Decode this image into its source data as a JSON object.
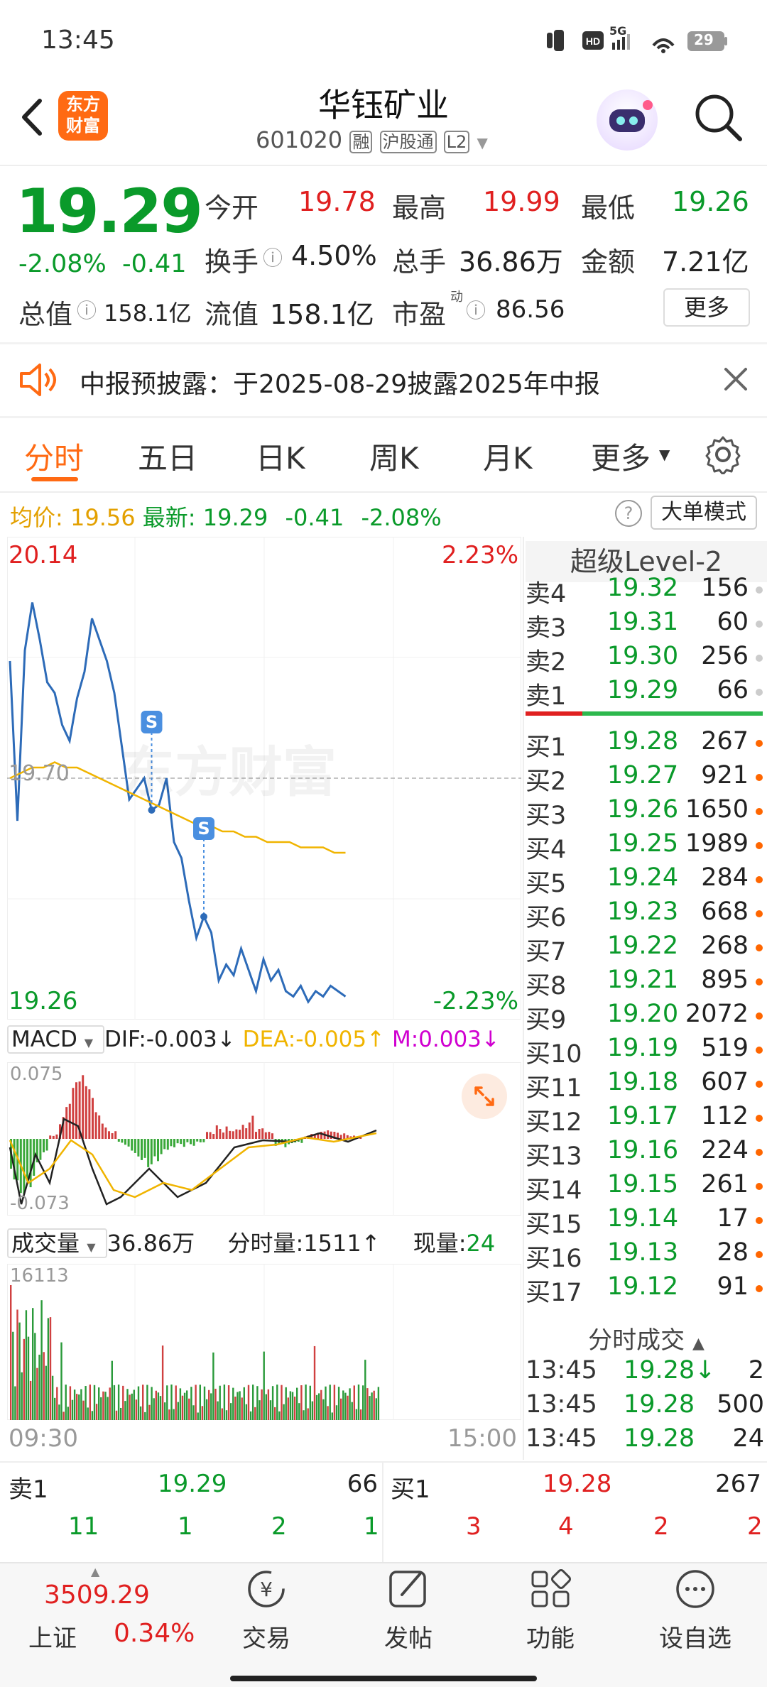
{
  "status": {
    "time": "13:45",
    "battery": "29",
    "network": "5G"
  },
  "header": {
    "title": "华钰矿业",
    "code": "601020",
    "tags": [
      "融",
      "沪股通",
      "L2"
    ],
    "logo_text": "东方财富"
  },
  "quote": {
    "price": "19.29",
    "change_pct": "-2.08%",
    "change": "-0.41",
    "open_label": "今开",
    "open": "19.78",
    "high_label": "最高",
    "high": "19.99",
    "low_label": "最低",
    "low": "19.26",
    "turnover_label": "换手",
    "turnover": "4.50%",
    "volume_label": "总手",
    "volume": "36.86万",
    "amount_label": "金额",
    "amount": "7.21亿",
    "mktcap_label": "总值",
    "mktcap": "158.1亿",
    "float_label": "流值",
    "float": "158.1亿",
    "pe_label": "市盈",
    "pe_sup": "动",
    "pe": "86.56",
    "more_label": "更多"
  },
  "notice": {
    "text": "中报预披露：于2025-08-29披露2025年中报"
  },
  "tabs": [
    {
      "label": "分时"
    },
    {
      "label": "五日"
    },
    {
      "label": "日K"
    },
    {
      "label": "周K"
    },
    {
      "label": "月K"
    },
    {
      "label": "更多"
    }
  ],
  "info_bar": {
    "avg_label": "均价:",
    "avg": "19.56",
    "latest_label": "最新:",
    "latest": "19.29",
    "chg": "-0.41",
    "pct": "-2.08%",
    "mode_btn": "大单模式"
  },
  "chart_data": {
    "type": "line",
    "title": "",
    "y_top_label": "20.14",
    "y_bottom_label": "19.26",
    "y_mid_label": "19.70",
    "pct_top_label": "2.23%",
    "pct_bottom_label": "-2.23%",
    "ylim": [
      19.26,
      20.14
    ],
    "x_start_label": "09:30",
    "x_end_label": "15:00",
    "watermark": "东方财富",
    "markers": [
      "S",
      "S"
    ],
    "price_series": [
      19.92,
      19.62,
      19.94,
      20.03,
      19.96,
      19.88,
      19.86,
      19.8,
      19.77,
      19.85,
      19.9,
      20.0,
      19.96,
      19.92,
      19.86,
      19.76,
      19.66,
      19.68,
      19.7,
      19.64,
      19.65,
      19.7,
      19.58,
      19.55,
      19.47,
      19.4,
      19.44,
      19.41,
      19.32,
      19.35,
      19.33,
      19.38,
      19.34,
      19.3,
      19.36,
      19.32,
      19.34,
      19.3,
      19.29,
      19.31,
      19.28,
      19.3,
      19.29,
      19.31,
      19.3,
      19.29
    ],
    "avg_series": [
      19.7,
      19.71,
      19.72,
      19.72,
      19.73,
      19.72,
      19.72,
      19.71,
      19.7,
      19.69,
      19.68,
      19.67,
      19.66,
      19.65,
      19.64,
      19.63,
      19.62,
      19.61,
      19.61,
      19.6,
      19.6,
      19.59,
      19.59,
      19.58,
      19.58,
      19.58,
      19.57,
      19.57,
      19.57,
      19.56,
      19.56
    ]
  },
  "macd": {
    "name": "MACD",
    "dif": "DIF:-0.003↓",
    "dea": "DEA:-0.005↑",
    "m": "M:0.003↓",
    "top": "0.075",
    "bottom": "-0.073"
  },
  "volume": {
    "name": "成交量",
    "total": "36.86万",
    "tick_label": "分时量:1511↑",
    "now_label": "现量:",
    "now": "24",
    "max": "16113"
  },
  "level2": {
    "title": "超级Level-2",
    "asks": [
      {
        "name": "卖4",
        "price": "19.32",
        "vol": "156"
      },
      {
        "name": "卖3",
        "price": "19.31",
        "vol": "60"
      },
      {
        "name": "卖2",
        "price": "19.30",
        "vol": "256"
      },
      {
        "name": "卖1",
        "price": "19.29",
        "vol": "66"
      }
    ],
    "bids": [
      {
        "name": "买1",
        "price": "19.28",
        "vol": "267"
      },
      {
        "name": "买2",
        "price": "19.27",
        "vol": "921"
      },
      {
        "name": "买3",
        "price": "19.26",
        "vol": "1650"
      },
      {
        "name": "买4",
        "price": "19.25",
        "vol": "1989"
      },
      {
        "name": "买5",
        "price": "19.24",
        "vol": "284"
      },
      {
        "name": "买6",
        "price": "19.23",
        "vol": "668"
      },
      {
        "name": "买7",
        "price": "19.22",
        "vol": "268"
      },
      {
        "name": "买8",
        "price": "19.21",
        "vol": "895"
      },
      {
        "name": "买9",
        "price": "19.20",
        "vol": "2072"
      },
      {
        "name": "买10",
        "price": "19.19",
        "vol": "519"
      },
      {
        "name": "买11",
        "price": "19.18",
        "vol": "607"
      },
      {
        "name": "买12",
        "price": "19.17",
        "vol": "112"
      },
      {
        "name": "买13",
        "price": "19.16",
        "vol": "224"
      },
      {
        "name": "买14",
        "price": "19.15",
        "vol": "261"
      },
      {
        "name": "买15",
        "price": "19.14",
        "vol": "17"
      },
      {
        "name": "买16",
        "price": "19.13",
        "vol": "28"
      },
      {
        "name": "买17",
        "price": "19.12",
        "vol": "91"
      }
    ],
    "ticks_title": "分时成交",
    "ticks": [
      {
        "time": "13:45",
        "price": "19.28↓",
        "vol": "2"
      },
      {
        "time": "13:45",
        "price": "19.28",
        "vol": "500"
      },
      {
        "time": "13:45",
        "price": "19.28",
        "vol": "24"
      }
    ]
  },
  "queue": {
    "sell_label": "卖1",
    "sell_price": "19.29",
    "sell_vol": "66",
    "buy_label": "买1",
    "buy_price": "19.28",
    "buy_vol": "267",
    "sell_orders": [
      "11",
      "1",
      "2",
      "1"
    ],
    "buy_orders": [
      "3",
      "4",
      "2",
      "2"
    ]
  },
  "bottom_nav": {
    "index_value": "3509.29",
    "index_name": "上证",
    "index_pct": "0.34%",
    "items": [
      {
        "label": "交易"
      },
      {
        "label": "发帖"
      },
      {
        "label": "功能"
      },
      {
        "label": "设自选"
      }
    ]
  }
}
